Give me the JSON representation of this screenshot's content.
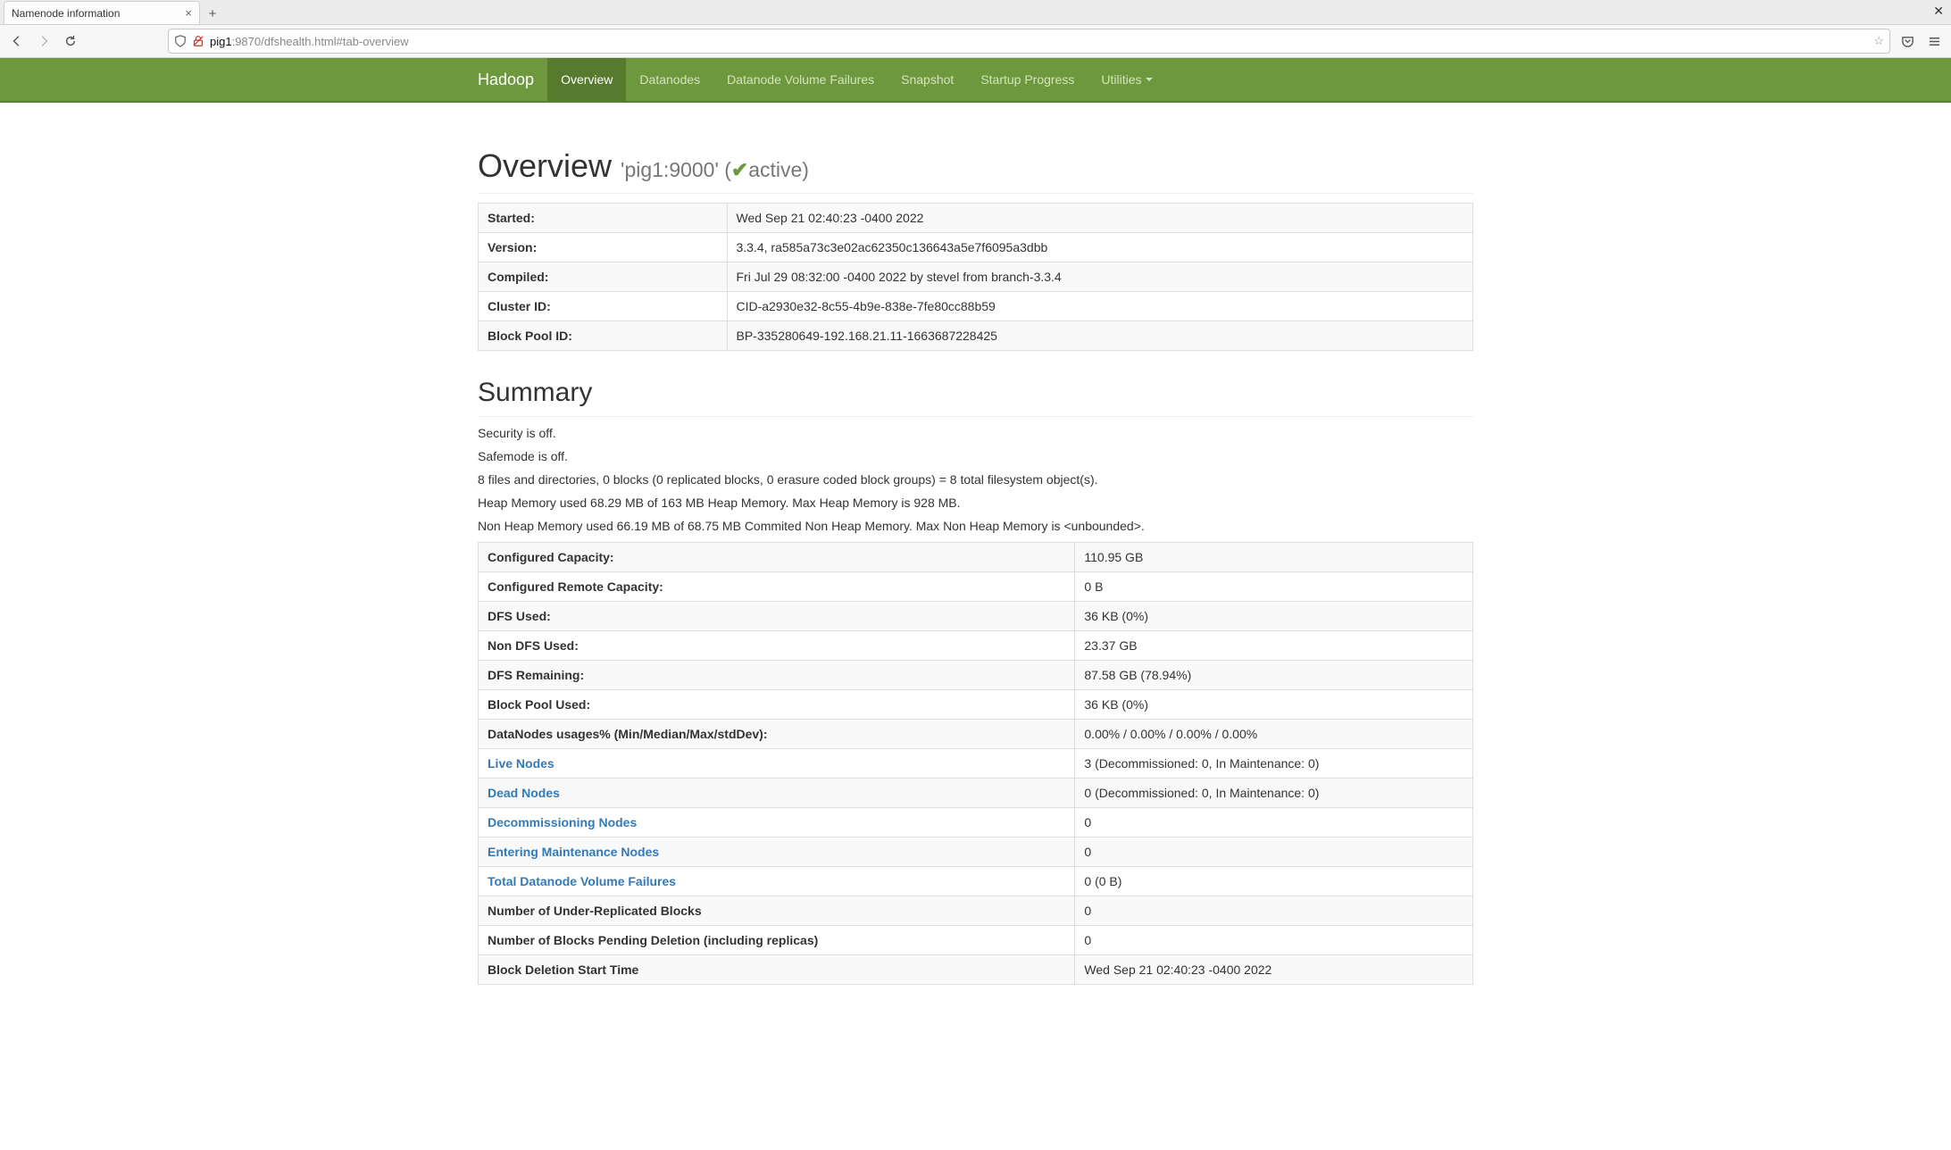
{
  "browser": {
    "tab_title": "Namenode information",
    "url_host": "pig1",
    "url_rest": ":9870/dfshealth.html#tab-overview"
  },
  "nav": {
    "brand": "Hadoop",
    "items": [
      {
        "label": "Overview",
        "active": true
      },
      {
        "label": "Datanodes",
        "active": false
      },
      {
        "label": "Datanode Volume Failures",
        "active": false
      },
      {
        "label": "Snapshot",
        "active": false
      },
      {
        "label": "Startup Progress",
        "active": false
      },
      {
        "label": "Utilities",
        "active": false,
        "dropdown": true
      }
    ]
  },
  "overview": {
    "heading": "Overview",
    "subparen_open": "'pig1:9000' (",
    "status": "active",
    "subparen_close": ")",
    "rows": [
      {
        "k": "Started:",
        "v": "Wed Sep 21 02:40:23 -0400 2022"
      },
      {
        "k": "Version:",
        "v": "3.3.4, ra585a73c3e02ac62350c136643a5e7f6095a3dbb"
      },
      {
        "k": "Compiled:",
        "v": "Fri Jul 29 08:32:00 -0400 2022 by stevel from branch-3.3.4"
      },
      {
        "k": "Cluster ID:",
        "v": "CID-a2930e32-8c55-4b9e-838e-7fe80cc88b59"
      },
      {
        "k": "Block Pool ID:",
        "v": "BP-335280649-192.168.21.11-1663687228425"
      }
    ]
  },
  "summary": {
    "heading": "Summary",
    "paragraphs": [
      "Security is off.",
      "Safemode is off.",
      "8 files and directories, 0 blocks (0 replicated blocks, 0 erasure coded block groups) = 8 total filesystem object(s).",
      "Heap Memory used 68.29 MB of 163 MB Heap Memory. Max Heap Memory is 928 MB.",
      "Non Heap Memory used 66.19 MB of 68.75 MB Commited Non Heap Memory. Max Non Heap Memory is <unbounded>."
    ],
    "rows": [
      {
        "k": "Configured Capacity:",
        "v": "110.95 GB",
        "link": false
      },
      {
        "k": "Configured Remote Capacity:",
        "v": "0 B",
        "link": false
      },
      {
        "k": "DFS Used:",
        "v": "36 KB (0%)",
        "link": false
      },
      {
        "k": "Non DFS Used:",
        "v": "23.37 GB",
        "link": false
      },
      {
        "k": "DFS Remaining:",
        "v": "87.58 GB (78.94%)",
        "link": false
      },
      {
        "k": "Block Pool Used:",
        "v": "36 KB (0%)",
        "link": false
      },
      {
        "k": "DataNodes usages% (Min/Median/Max/stdDev):",
        "v": "0.00% / 0.00% / 0.00% / 0.00%",
        "link": false
      },
      {
        "k": "Live Nodes",
        "v": "3 (Decommissioned: 0, In Maintenance: 0)",
        "link": true
      },
      {
        "k": "Dead Nodes",
        "v": "0 (Decommissioned: 0, In Maintenance: 0)",
        "link": true
      },
      {
        "k": "Decommissioning Nodes",
        "v": "0",
        "link": true
      },
      {
        "k": "Entering Maintenance Nodes",
        "v": "0",
        "link": true
      },
      {
        "k": "Total Datanode Volume Failures",
        "v": "0 (0 B)",
        "link": true
      },
      {
        "k": "Number of Under-Replicated Blocks",
        "v": "0",
        "link": false
      },
      {
        "k": "Number of Blocks Pending Deletion (including replicas)",
        "v": "0",
        "link": false
      },
      {
        "k": "Block Deletion Start Time",
        "v": "Wed Sep 21 02:40:23 -0400 2022",
        "link": false
      }
    ]
  },
  "watermarks": {
    "left": "",
    "right": ""
  }
}
